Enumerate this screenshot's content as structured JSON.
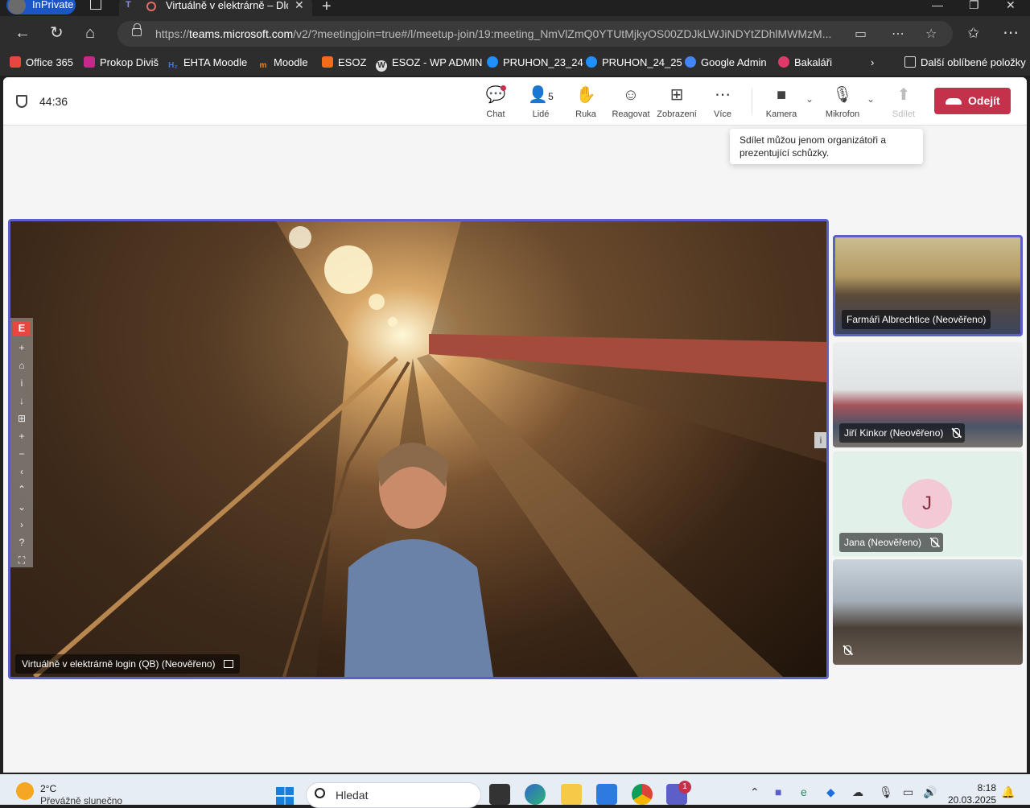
{
  "browser": {
    "inprivate_label": "InPrivate",
    "tab_title": "Virtuálně v elektrárně – Dlouh",
    "url_prefix": "https://",
    "url_host": "teams.microsoft.com",
    "url_path": "/v2/?meetingjoin=true#/l/meetup-join/19:meeting_NmVlZmQ0YTUtMjkyOS00ZDJkLWJiNDYtZDhlMWMzM..."
  },
  "favorites": {
    "items": [
      {
        "label": "Office 365",
        "icon": "office-icon",
        "color": "#e8473f"
      },
      {
        "label": "Prokop Diviš",
        "icon": "bookmark-icon",
        "color": "#c52a8a"
      },
      {
        "label": "EHTA Moodle",
        "icon": "h2-icon",
        "color": "#3a7bd5"
      },
      {
        "label": "Moodle",
        "icon": "moodle-icon",
        "color": "#f98012"
      },
      {
        "label": "ESOZ",
        "icon": "esoz-icon",
        "color": "#f26c1a"
      },
      {
        "label": "ESOZ - WP ADMIN",
        "icon": "wordpress-icon",
        "color": "#dddddd"
      },
      {
        "label": "PRUHON_23_24",
        "icon": "onedrive-icon",
        "color": "#1e90ff"
      },
      {
        "label": "PRUHON_24_25",
        "icon": "onedrive-icon",
        "color": "#1e90ff"
      },
      {
        "label": "Google Admin",
        "icon": "google-admin-icon",
        "color": "#4285f4"
      },
      {
        "label": "Bakaláři",
        "icon": "bakalari-icon",
        "color": "#e03a6a"
      }
    ],
    "other_label": "Další oblíbené položky"
  },
  "meeting": {
    "timer": "44:36",
    "toolbar": {
      "chat": "Chat",
      "people": "Lidé",
      "people_count": "5",
      "hand": "Ruka",
      "react": "Reagovat",
      "view": "Zobrazení",
      "more": "Více",
      "camera": "Kamera",
      "mic": "Mikrofon",
      "share": "Sdílet",
      "leave": "Odejít"
    },
    "tooltip": "Sdílet můžou jenom organizátoři a prezentující schůzky.",
    "main_video_label": "Virtuálně v elektrárně login (QB) (Neověřeno)",
    "participants": [
      {
        "name": "Farmáři Albrechtice (Neověřeno)",
        "muted": false
      },
      {
        "name": "Jiří Kinkor (Neověřeno)",
        "muted": true
      },
      {
        "name": "Jana (Neověřeno)",
        "muted": true,
        "initial": "J"
      },
      {
        "name": "",
        "muted": true
      }
    ],
    "accent_color": "#5b5fc7",
    "leave_color": "#c4314b"
  },
  "taskbar": {
    "weather_temp": "2°C",
    "weather_desc": "Převážně slunečno",
    "search_placeholder": "Hledat",
    "teams_badge": "1",
    "time": "8:18",
    "date": "20.03.2025"
  }
}
